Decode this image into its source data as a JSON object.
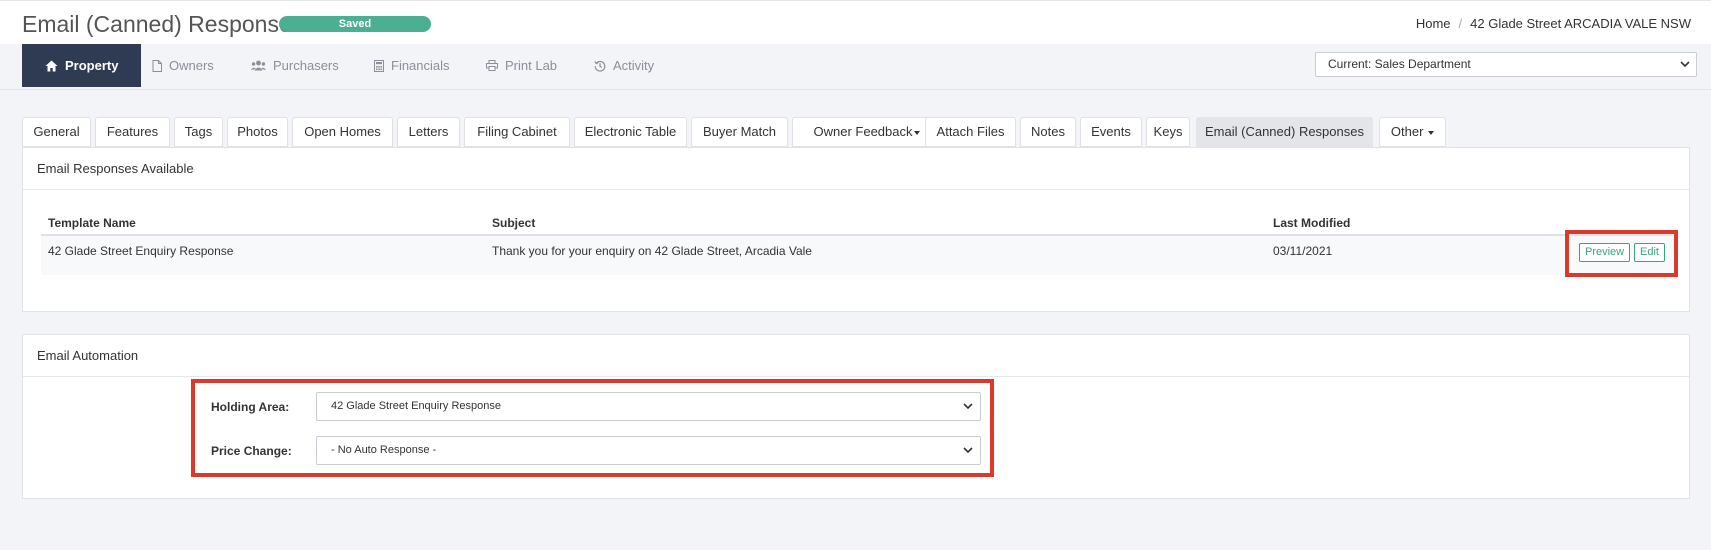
{
  "header": {
    "title": "Email (Canned) Response",
    "saved_badge": "Saved",
    "breadcrumb": [
      "Home",
      "42 Glade Street ARCADIA VALE NSW"
    ]
  },
  "nav": {
    "items": [
      {
        "label": "Property",
        "icon": "home-icon",
        "active": true
      },
      {
        "label": "Owners",
        "icon": "document-icon"
      },
      {
        "label": "Purchasers",
        "icon": "users-icon"
      },
      {
        "label": "Financials",
        "icon": "calculator-icon"
      },
      {
        "label": "Print Lab",
        "icon": "printer-icon"
      },
      {
        "label": "Activity",
        "icon": "history-icon"
      }
    ],
    "department_select": "Current: Sales Department"
  },
  "tabs": [
    {
      "label": "General"
    },
    {
      "label": "Features"
    },
    {
      "label": "Tags"
    },
    {
      "label": "Photos"
    },
    {
      "label": "Open Homes"
    },
    {
      "label": "Letters"
    },
    {
      "label": "Filing Cabinet"
    },
    {
      "label": "Electronic Table"
    },
    {
      "label": "Buyer Match"
    },
    {
      "label": "Owner Feedback",
      "dropdown": true
    },
    {
      "label": "Attach Files"
    },
    {
      "label": "Notes"
    },
    {
      "label": "Events"
    },
    {
      "label": "Keys"
    },
    {
      "label": "Email (Canned) Responses",
      "active": true
    },
    {
      "label": "Other",
      "dropdown": true
    }
  ],
  "responses_panel": {
    "title": "Email Responses Available",
    "columns": [
      "Template Name",
      "Subject",
      "Last Modified"
    ],
    "rows": [
      {
        "template_name": "42 Glade Street Enquiry Response",
        "subject": "Thank you for your enquiry on 42 Glade Street, Arcadia Vale",
        "last_modified": "03/11/2021",
        "actions": [
          "Preview",
          "Edit"
        ]
      }
    ]
  },
  "automation_panel": {
    "title": "Email Automation",
    "fields": [
      {
        "label": "Holding Area:",
        "value": "42 Glade Street Enquiry Response"
      },
      {
        "label": "Price Change:",
        "value": "- No Auto Response -"
      }
    ]
  },
  "colors": {
    "nav_active_bg": "#2f3b52",
    "saved_badge": "#4caf91",
    "action_button": "#3aa57c",
    "highlight_box": "#d93a2b"
  }
}
